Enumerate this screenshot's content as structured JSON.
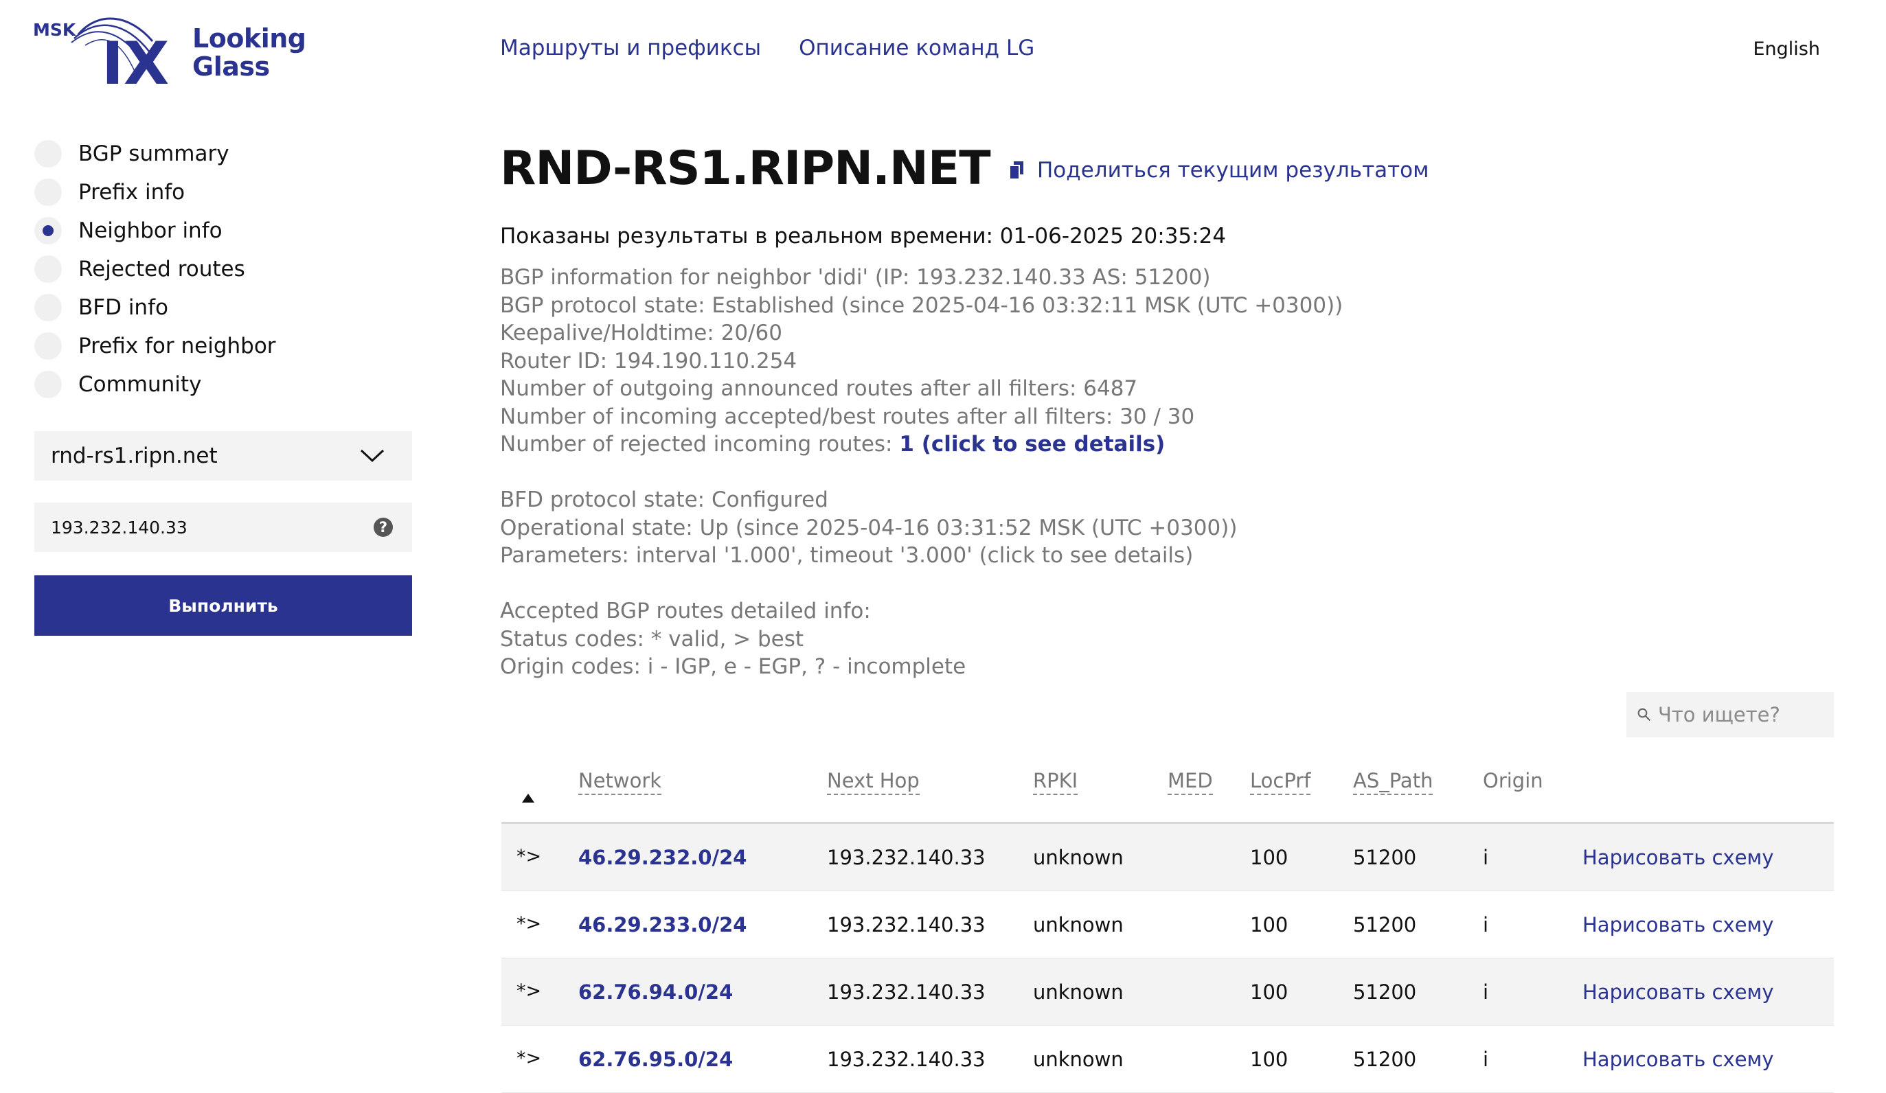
{
  "header": {
    "logo": {
      "mark": "MSK IX",
      "text": "Looking\nGlass"
    },
    "nav": [
      {
        "label": "Маршруты и префиксы"
      },
      {
        "label": "Описание команд LG"
      }
    ],
    "language": "English"
  },
  "sidebar": {
    "modes": [
      {
        "label": "BGP summary",
        "checked": false
      },
      {
        "label": "Prefix info",
        "checked": false
      },
      {
        "label": "Neighbor info",
        "checked": true
      },
      {
        "label": "Rejected routes",
        "checked": false
      },
      {
        "label": "BFD info",
        "checked": false
      },
      {
        "label": "Prefix for neighbor",
        "checked": false
      },
      {
        "label": "Community",
        "checked": false
      }
    ],
    "router_select": {
      "value": "rnd-rs1.ripn.net"
    },
    "query": {
      "value": "193.232.140.33"
    },
    "run_button": "Выполнить"
  },
  "main": {
    "title": "RND-RS1.RIPN.NET",
    "share_label": "Поделиться текущим результатом",
    "realtime": "Показаны результаты в реальном времени: 01-06-2025 20:35:24",
    "info_lines": [
      "BGP information for neighbor 'didi' (IP: 193.232.140.33 AS: 51200)",
      "BGP protocol state: Established (since 2025-04-16 03:32:11 MSK (UTC +0300))",
      "Keepalive/Holdtime: 20/60",
      "Router ID: 194.190.110.254",
      "Number of outgoing announced routes after all filters: 6487",
      "Number of incoming accepted/best routes after all filters: 30 / 30"
    ],
    "rejected": {
      "label": "Number of rejected incoming routes:",
      "link": "1 (click to see details)"
    },
    "bfd_lines": [
      "BFD protocol state: Configured",
      "Operational state: Up (since 2025-04-16 03:31:52 MSK (UTC +0300))",
      "Parameters: interval '1.000', timeout '3.000' (click to see details)"
    ],
    "accepted_lines": [
      "Accepted BGP routes detailed info:",
      "Status codes: * valid, > best",
      "Origin codes: i - IGP, e - EGP, ? - incomplete"
    ],
    "search": {
      "placeholder": "Что ищете?"
    },
    "table": {
      "headers": {
        "network": "Network",
        "next_hop": "Next Hop",
        "rpki": "RPKI",
        "med": "MED",
        "locprf": "LocPrf",
        "as_path": "AS_Path",
        "origin": "Origin"
      },
      "rows": [
        {
          "status": "*>",
          "network": "46.29.232.0/24",
          "next_hop": "193.232.140.33",
          "rpki": "unknown",
          "med": "",
          "locprf": "100",
          "as_path": "51200",
          "origin": "i",
          "action": "Нарисовать схему"
        },
        {
          "status": "*>",
          "network": "46.29.233.0/24",
          "next_hop": "193.232.140.33",
          "rpki": "unknown",
          "med": "",
          "locprf": "100",
          "as_path": "51200",
          "origin": "i",
          "action": "Нарисовать схему"
        },
        {
          "status": "*>",
          "network": "62.76.94.0/24",
          "next_hop": "193.232.140.33",
          "rpki": "unknown",
          "med": "",
          "locprf": "100",
          "as_path": "51200",
          "origin": "i",
          "action": "Нарисовать схему"
        },
        {
          "status": "*>",
          "network": "62.76.95.0/24",
          "next_hop": "193.232.140.33",
          "rpki": "unknown",
          "med": "",
          "locprf": "100",
          "as_path": "51200",
          "origin": "i",
          "action": "Нарисовать схему"
        }
      ]
    }
  },
  "colors": {
    "brand": "#2b3390",
    "text": "#111111",
    "muted": "#777777",
    "field_bg": "#f3f3f3"
  },
  "icons": {
    "logo": "msk-ix-logo-icon",
    "dropdown": "chevron-down-icon",
    "help": "question-icon",
    "share": "copy-icon",
    "search": "search-icon",
    "sort": "sort-up-icon"
  }
}
